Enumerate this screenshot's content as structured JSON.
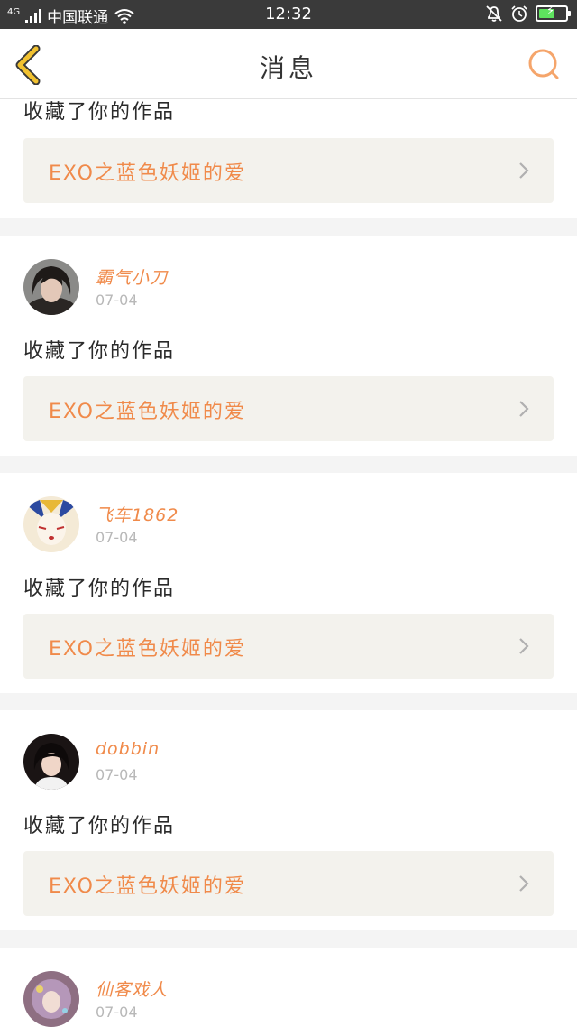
{
  "status_bar": {
    "network": "4G",
    "carrier": "中国联通",
    "time": "12:32",
    "icons": [
      "signal-icon",
      "wifi-icon",
      "mute-bell-icon",
      "alarm-icon",
      "battery-charging-icon"
    ]
  },
  "header": {
    "title": "消息",
    "back_icon": "back-chevron-icon",
    "search_icon": "search-icon",
    "accent_color": "#f5a56b",
    "back_color": "#f2c230"
  },
  "colors": {
    "name_color": "#f08a4a",
    "card_bg": "#ffffff",
    "work_bg": "#f3f2ed",
    "page_bg": "#f4f4f4"
  },
  "top_partial": {
    "action": "收藏了你的作品",
    "work_title": "EXO之蓝色妖姬的爱"
  },
  "messages": [
    {
      "username": "霸气小刀",
      "date": "07-04",
      "action": "收藏了你的作品",
      "work_title": "EXO之蓝色妖姬的爱",
      "avatar": "avatar-photo-girl"
    },
    {
      "username": "飞车1862",
      "date": "07-04",
      "action": "收藏了你的作品",
      "work_title": "EXO之蓝色妖姬的爱",
      "avatar": "avatar-cartoon-jester"
    },
    {
      "username": "dobbin",
      "date": "07-04",
      "action": "收藏了你的作品",
      "work_title": "EXO之蓝色妖姬的爱",
      "avatar": "avatar-photo-girl-dark"
    },
    {
      "username": "仙客戏人",
      "date": "07-04",
      "action": "",
      "work_title": "",
      "avatar": "avatar-photo-bubble"
    }
  ]
}
